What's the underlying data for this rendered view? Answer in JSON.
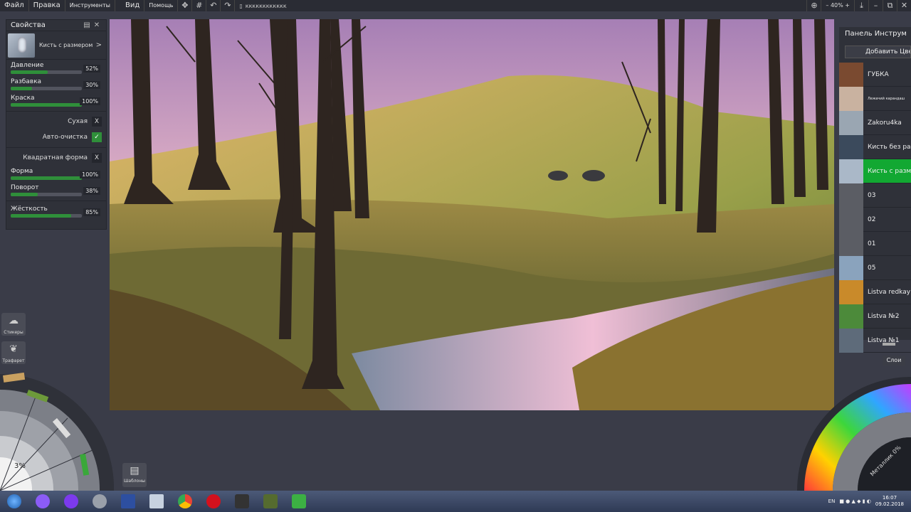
{
  "menu": {
    "file": "Файл",
    "edit": "Правка",
    "tools": "Инструменты",
    "view": "Вид",
    "help": "Помощь",
    "doc_name": "кккккккккккк",
    "zoom": "40%"
  },
  "properties": {
    "title": "Свойства",
    "brush_name": "Кисть с размером",
    "sliders": [
      {
        "label": "Давление",
        "value": "52%",
        "fill": 0.52
      },
      {
        "label": "Разбавка",
        "value": "30%",
        "fill": 0.3
      },
      {
        "label": "Краска",
        "value": "100%",
        "fill": 1.0
      },
      {
        "label": "Форма",
        "value": "100%",
        "fill": 1.0
      },
      {
        "label": "Поворот",
        "value": "38%",
        "fill": 0.38
      },
      {
        "label": "Жёсткость",
        "value": "85%",
        "fill": 0.85
      }
    ],
    "dry_label": "Сухая",
    "dry_state": "X",
    "autoclean_label": "Авто-очистка",
    "autoclean_state": "✓",
    "square_label": "Квадратная форма",
    "square_state": "X"
  },
  "dock": {
    "stickers": "Стикеры",
    "stencil": "Трафарет",
    "templates": "Шаблоны",
    "zoom": "3%"
  },
  "tools_panel": {
    "title": "Панель Инструм",
    "add_color": "Добавить Цве",
    "items": [
      {
        "name": "ГУБКА",
        "color": "#7a4a30"
      },
      {
        "name": "Лежачий карандаш",
        "color": "#c9b2a0"
      },
      {
        "name": "Zakoru4ka",
        "color": "#9aa6b2"
      },
      {
        "name": "Кисть без раз",
        "color": "#3b4a5c"
      },
      {
        "name": "Кисть с разм",
        "color": "#aab8c8"
      },
      {
        "name": "03",
        "color": "#5b5d64"
      },
      {
        "name": "02",
        "color": "#5b5d64"
      },
      {
        "name": "01",
        "color": "#5b5d64"
      },
      {
        "name": "05",
        "color": "#8aa3bd"
      },
      {
        "name": "Listva redkay",
        "color": "#c98a2a"
      },
      {
        "name": "Listva №2",
        "color": "#4c8a3a"
      },
      {
        "name": "Listva №1",
        "color": "#5e6b7a"
      }
    ],
    "active_index": 4,
    "layers": "Слои"
  },
  "color_wheel": {
    "metallic": "Металлик 0%"
  },
  "taskbar": {
    "lang": "EN",
    "time": "16:07",
    "date": "09.02.2018"
  }
}
